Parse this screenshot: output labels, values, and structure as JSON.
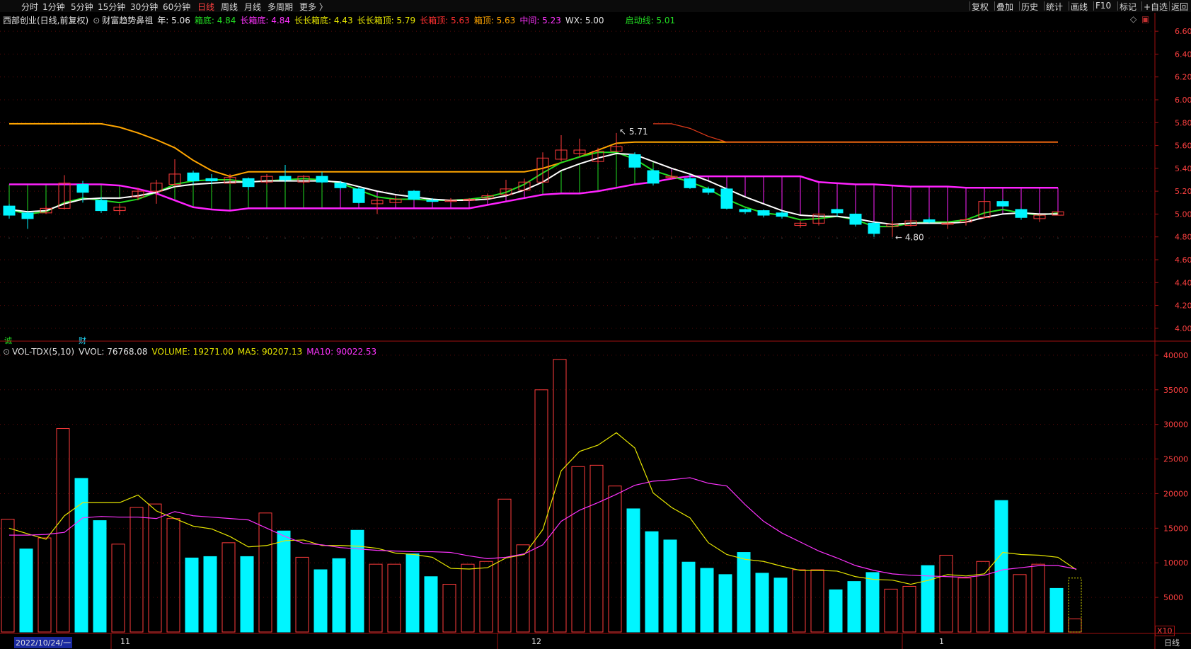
{
  "colors": {
    "up": "#ff3b3b",
    "down": "#00f5ff",
    "ma5": "#e6e600",
    "ma10": "#e020e0",
    "box_top": "#ffa500",
    "long_top": "#e03a1a",
    "box_bottom": "#ff22ff",
    "mid": "#ffffff",
    "start": "#22dd22",
    "axis": "#a01010",
    "grid": "#5a0a0a"
  },
  "toolbar": {
    "periods": [
      "分时",
      "1分钟",
      "5分钟",
      "15分钟",
      "30分钟",
      "60分钟",
      "日线",
      "周线",
      "月线",
      "多周期",
      "更多 〉"
    ],
    "active": "日线",
    "right_tools": [
      "复权",
      "叠加",
      "历史",
      "统计",
      "画线",
      "F10",
      "标记",
      "+自选",
      "返回"
    ]
  },
  "main_legend": {
    "stock": "西部创业(日线,前复权)",
    "indicator": "财富趋势鼻祖",
    "items": [
      {
        "label": "年: 5.06",
        "color": "#e6e6e6"
      },
      {
        "label": "箱底: 4.84",
        "color": "#22dd22"
      },
      {
        "label": "长箱底: 4.84",
        "color": "#ff33ff"
      },
      {
        "label": "长长箱底: 4.43",
        "color": "#e6e600"
      },
      {
        "label": "长长箱顶: 5.79",
        "color": "#e6e600"
      },
      {
        "label": "长箱顶: 5.63",
        "color": "#ff3030"
      },
      {
        "label": "箱顶: 5.63",
        "color": "#ffa500"
      },
      {
        "label": "中间: 5.23",
        "color": "#ff33ff"
      },
      {
        "label": "WX: 5.00",
        "color": "#e6e6e6"
      },
      {
        "label": "启动线: 5.01",
        "color": "#22dd22"
      }
    ]
  },
  "vol_legend": {
    "name": "VOL-TDX(5,10)",
    "items": [
      {
        "label": "VVOL: 76768.08",
        "color": "#e6e6e6"
      },
      {
        "label": "VOLUME: 19271.00",
        "color": "#e6e600"
      },
      {
        "label": "MA5: 90207.13",
        "color": "#e6e600"
      },
      {
        "label": "MA10: 90022.53",
        "color": "#ff33ff"
      }
    ]
  },
  "badges": {
    "left": "诚",
    "right": "财",
    "x10": "X10",
    "period_tab": "日线"
  },
  "date_axis": {
    "start": "2022/10/24/一",
    "months": [
      "11",
      "12",
      "1"
    ]
  },
  "chart_data": [
    {
      "type": "candlestick",
      "title": "西部创业(日线,前复权)",
      "ylim": [
        3.9,
        6.7
      ],
      "yticks": [
        4.0,
        4.2,
        4.4,
        4.6,
        4.8,
        5.0,
        5.2,
        5.4,
        5.6,
        5.8,
        6.0,
        6.2,
        6.4,
        6.6
      ],
      "annotations": [
        {
          "label": "5.71",
          "index": 33
        },
        {
          "label": "4.80",
          "index": 48
        }
      ],
      "candles": [
        {
          "o": 5.07,
          "c": 4.99,
          "h": 5.09,
          "l": 4.96
        },
        {
          "o": 5.01,
          "c": 4.96,
          "h": 5.02,
          "l": 4.87
        },
        {
          "o": 5.01,
          "c": 5.05,
          "h": 5.07,
          "l": 5.0
        },
        {
          "o": 5.05,
          "c": 5.27,
          "h": 5.34,
          "l": 5.04
        },
        {
          "o": 5.26,
          "c": 5.19,
          "h": 5.29,
          "l": 5.1
        },
        {
          "o": 5.12,
          "c": 5.03,
          "h": 5.15,
          "l": 5.01
        },
        {
          "o": 5.03,
          "c": 5.06,
          "h": 5.09,
          "l": 4.99
        },
        {
          "o": 5.15,
          "c": 5.2,
          "h": 5.23,
          "l": 5.12
        },
        {
          "o": 5.2,
          "c": 5.27,
          "h": 5.3,
          "l": 5.09
        },
        {
          "o": 5.26,
          "c": 5.35,
          "h": 5.48,
          "l": 5.24
        },
        {
          "o": 5.36,
          "c": 5.29,
          "h": 5.38,
          "l": 5.26
        },
        {
          "o": 5.31,
          "c": 5.29,
          "h": 5.35,
          "l": 5.26
        },
        {
          "o": 5.27,
          "c": 5.32,
          "h": 5.35,
          "l": 5.27
        },
        {
          "o": 5.31,
          "c": 5.24,
          "h": 5.32,
          "l": 5.21
        },
        {
          "o": 5.28,
          "c": 5.33,
          "h": 5.35,
          "l": 5.26
        },
        {
          "o": 5.33,
          "c": 5.3,
          "h": 5.43,
          "l": 5.28
        },
        {
          "o": 5.28,
          "c": 5.33,
          "h": 5.34,
          "l": 5.26
        },
        {
          "o": 5.33,
          "c": 5.28,
          "h": 5.37,
          "l": 5.27
        },
        {
          "o": 5.27,
          "c": 5.23,
          "h": 5.29,
          "l": 5.21
        },
        {
          "o": 5.22,
          "c": 5.1,
          "h": 5.24,
          "l": 5.09
        },
        {
          "o": 5.09,
          "c": 5.12,
          "h": 5.14,
          "l": 5.0
        },
        {
          "o": 5.1,
          "c": 5.13,
          "h": 5.16,
          "l": 5.09
        },
        {
          "o": 5.2,
          "c": 5.13,
          "h": 5.21,
          "l": 5.12
        },
        {
          "o": 5.12,
          "c": 5.11,
          "h": 5.14,
          "l": 5.1
        },
        {
          "o": 5.11,
          "c": 5.12,
          "h": 5.14,
          "l": 5.1
        },
        {
          "o": 5.12,
          "c": 5.13,
          "h": 5.14,
          "l": 5.11
        },
        {
          "o": 5.14,
          "c": 5.16,
          "h": 5.18,
          "l": 5.12
        },
        {
          "o": 5.17,
          "c": 5.22,
          "h": 5.3,
          "l": 5.16
        },
        {
          "o": 5.21,
          "c": 5.28,
          "h": 5.31,
          "l": 5.2
        },
        {
          "o": 5.28,
          "c": 5.49,
          "h": 5.54,
          "l": 5.27
        },
        {
          "o": 5.48,
          "c": 5.56,
          "h": 5.69,
          "l": 5.46
        },
        {
          "o": 5.53,
          "c": 5.56,
          "h": 5.66,
          "l": 5.5
        },
        {
          "o": 5.46,
          "c": 5.55,
          "h": 5.58,
          "l": 5.44
        },
        {
          "o": 5.55,
          "c": 5.59,
          "h": 5.71,
          "l": 5.54
        },
        {
          "o": 5.52,
          "c": 5.41,
          "h": 5.54,
          "l": 5.39
        },
        {
          "o": 5.38,
          "c": 5.27,
          "h": 5.4,
          "l": 5.25
        },
        {
          "o": 5.33,
          "c": 5.33,
          "h": 5.37,
          "l": 5.3
        },
        {
          "o": 5.31,
          "c": 5.23,
          "h": 5.34,
          "l": 5.22
        },
        {
          "o": 5.22,
          "c": 5.19,
          "h": 5.24,
          "l": 5.17
        },
        {
          "o": 5.22,
          "c": 5.05,
          "h": 5.23,
          "l": 5.04
        },
        {
          "o": 5.04,
          "c": 5.02,
          "h": 5.05,
          "l": 5.0
        },
        {
          "o": 5.03,
          "c": 4.99,
          "h": 5.04,
          "l": 4.97
        },
        {
          "o": 5.01,
          "c": 4.98,
          "h": 5.03,
          "l": 4.96
        },
        {
          "o": 4.9,
          "c": 4.92,
          "h": 4.94,
          "l": 4.88
        },
        {
          "o": 4.92,
          "c": 5.0,
          "h": 5.01,
          "l": 4.9
        },
        {
          "o": 5.04,
          "c": 5.01,
          "h": 5.05,
          "l": 4.98
        },
        {
          "o": 5.0,
          "c": 4.91,
          "h": 5.01,
          "l": 4.89
        },
        {
          "o": 4.92,
          "c": 4.83,
          "h": 4.93,
          "l": 4.8
        },
        {
          "o": 4.89,
          "c": 4.91,
          "h": 4.94,
          "l": 4.8
        },
        {
          "o": 4.9,
          "c": 4.94,
          "h": 4.95,
          "l": 4.89
        },
        {
          "o": 4.95,
          "c": 4.93,
          "h": 4.97,
          "l": 4.92
        },
        {
          "o": 4.91,
          "c": 4.92,
          "h": 4.94,
          "l": 4.87
        },
        {
          "o": 4.93,
          "c": 4.95,
          "h": 4.97,
          "l": 4.9
        },
        {
          "o": 4.97,
          "c": 5.11,
          "h": 5.12,
          "l": 4.96
        },
        {
          "o": 5.11,
          "c": 5.07,
          "h": 5.13,
          "l": 5.06
        },
        {
          "o": 5.04,
          "c": 4.97,
          "h": 5.05,
          "l": 4.95
        },
        {
          "o": 4.96,
          "c": 4.99,
          "h": 5.0,
          "l": 4.93
        },
        {
          "o": 4.99,
          "c": 5.02,
          "h": 5.02,
          "l": 4.99
        }
      ],
      "series": [
        {
          "type": "step",
          "color": "#ffa500",
          "values": [
            5.79,
            5.79,
            5.79,
            5.79,
            5.79,
            5.79,
            5.76,
            5.71,
            5.65,
            5.58,
            5.47,
            5.38,
            5.33,
            5.37,
            5.37,
            5.37,
            5.37,
            5.37,
            5.37,
            5.37,
            5.37,
            5.37,
            5.37,
            5.37,
            5.37,
            5.37,
            5.37,
            5.37,
            5.37,
            5.4,
            5.45,
            5.5,
            5.56,
            5.62,
            5.63,
            5.63,
            5.63,
            5.63,
            5.63,
            5.63,
            5.63,
            5.63,
            5.63,
            5.63,
            5.63,
            5.63,
            5.63,
            5.63,
            5.63,
            5.63,
            5.63,
            5.63,
            5.63,
            5.63,
            5.63,
            5.63,
            5.63,
            5.63
          ]
        },
        {
          "type": "line",
          "color": "#e03a1a",
          "values": [
            null,
            null,
            null,
            null,
            null,
            null,
            null,
            null,
            null,
            null,
            null,
            null,
            null,
            null,
            null,
            null,
            null,
            null,
            null,
            null,
            null,
            null,
            null,
            null,
            null,
            null,
            null,
            null,
            null,
            null,
            null,
            null,
            null,
            null,
            null,
            5.79,
            5.79,
            5.75,
            5.68,
            5.63,
            5.63,
            5.63,
            5.63,
            5.63,
            5.63,
            5.63,
            5.63,
            5.63,
            5.63,
            5.63,
            5.63,
            5.63,
            5.63,
            5.63,
            5.63,
            5.63,
            5.63,
            5.63
          ]
        },
        {
          "type": "band",
          "color": "#ff22ff",
          "values": [
            5.26,
            5.26,
            5.26,
            5.26,
            5.26,
            5.26,
            5.25,
            5.22,
            5.18,
            5.12,
            5.06,
            5.04,
            5.03,
            5.05,
            5.05,
            5.05,
            5.05,
            5.05,
            5.05,
            5.05,
            5.05,
            5.05,
            5.05,
            5.05,
            5.05,
            5.05,
            5.08,
            5.11,
            5.14,
            5.17,
            5.18,
            5.18,
            5.2,
            5.23,
            5.26,
            5.28,
            5.31,
            5.33,
            5.33,
            5.33,
            5.33,
            5.33,
            5.33,
            5.33,
            5.28,
            5.27,
            5.26,
            5.26,
            5.25,
            5.24,
            5.24,
            5.24,
            5.23,
            5.23,
            5.23,
            5.23,
            5.23,
            5.23
          ]
        },
        {
          "type": "line",
          "color": "#ffffff",
          "values": [
            5.04,
            5.02,
            5.03,
            5.09,
            5.13,
            5.14,
            5.14,
            5.16,
            5.19,
            5.24,
            5.26,
            5.27,
            5.28,
            5.28,
            5.29,
            5.29,
            5.29,
            5.29,
            5.28,
            5.24,
            5.2,
            5.17,
            5.15,
            5.13,
            5.12,
            5.12,
            5.13,
            5.16,
            5.21,
            5.28,
            5.38,
            5.44,
            5.49,
            5.53,
            5.52,
            5.46,
            5.4,
            5.35,
            5.29,
            5.22,
            5.15,
            5.09,
            5.03,
            4.99,
            4.98,
            4.98,
            4.96,
            4.93,
            4.91,
            4.92,
            4.92,
            4.92,
            4.93,
            4.97,
            5.0,
            5.01,
            5.0,
            5.0
          ]
        },
        {
          "type": "line",
          "color": "#22dd22",
          "values": [
            5.04,
            5.0,
            5.02,
            5.1,
            5.14,
            5.12,
            5.1,
            5.13,
            5.19,
            5.26,
            5.29,
            5.3,
            5.3,
            5.28,
            5.29,
            5.3,
            5.31,
            5.3,
            5.27,
            5.21,
            5.15,
            5.13,
            5.13,
            5.12,
            5.12,
            5.13,
            5.15,
            5.19,
            5.26,
            5.36,
            5.45,
            5.5,
            5.54,
            5.54,
            5.48,
            5.38,
            5.33,
            5.28,
            5.22,
            5.13,
            5.06,
            5.01,
            4.99,
            4.95,
            4.96,
            4.98,
            4.95,
            4.89,
            4.89,
            4.92,
            4.93,
            4.93,
            4.95,
            5.01,
            5.04,
            5.01,
            4.99,
            5.01
          ]
        }
      ]
    },
    {
      "type": "bar",
      "title": "VOL-TDX(5,10)",
      "ylim": [
        0,
        40500
      ],
      "yticks": [
        5000,
        10000,
        15000,
        20000,
        25000,
        30000,
        35000,
        40000
      ],
      "volumes": [
        16300,
        12000,
        13600,
        29400,
        22200,
        16100,
        12700,
        18000,
        18500,
        16400,
        10700,
        10900,
        12900,
        10900,
        17200,
        14600,
        10800,
        9000,
        10600,
        14700,
        9800,
        9800,
        11300,
        8000,
        6900,
        9800,
        10200,
        19200,
        12600,
        35000,
        39400,
        23900,
        24100,
        21100,
        17800,
        14500,
        13300,
        10100,
        9200,
        8300,
        11500,
        8500,
        7800,
        9000,
        9000,
        6100,
        7300,
        8600,
        6200,
        6600,
        9600,
        11100,
        7800,
        10200,
        19000,
        8300,
        9800,
        6300,
        1900
      ],
      "candle_up": [
        true,
        false,
        true,
        true,
        false,
        false,
        true,
        true,
        true,
        true,
        false,
        false,
        true,
        false,
        true,
        false,
        true,
        false,
        false,
        false,
        true,
        true,
        false,
        false,
        true,
        true,
        true,
        true,
        true,
        true,
        true,
        true,
        true,
        true,
        false,
        false,
        false,
        false,
        false,
        false,
        false,
        false,
        false,
        true,
        true,
        false,
        false,
        false,
        true,
        true,
        false,
        true,
        true,
        true,
        false,
        true,
        true,
        false
      ],
      "series": [
        {
          "name": "MA5",
          "color": "#e6e600",
          "values": [
            15000,
            14200,
            13400,
            16800,
            18700,
            18700,
            18700,
            19800,
            17500,
            16400,
            15300,
            14900,
            13800,
            12300,
            12500,
            13200,
            13300,
            12500,
            12500,
            12400,
            12100,
            11400,
            11200,
            10800,
            9200,
            9100,
            9300,
            10700,
            11200,
            14800,
            23300,
            26100,
            27000,
            28800,
            26600,
            20100,
            18000,
            16500,
            12900,
            11200,
            10500,
            10200,
            9500,
            8900,
            8900,
            8800,
            8000,
            7600,
            7500,
            6900,
            7500,
            8300,
            8100,
            8400,
            11500,
            11200,
            11100,
            10800,
            9000
          ]
        },
        {
          "name": "MA10",
          "color": "#ff33ff",
          "values": [
            14000,
            14000,
            14100,
            14400,
            16500,
            16700,
            16600,
            16600,
            16400,
            17400,
            16800,
            16600,
            16400,
            16200,
            15000,
            13800,
            12800,
            12600,
            12200,
            12000,
            11800,
            11700,
            11600,
            11600,
            11500,
            11000,
            10600,
            10800,
            11300,
            12600,
            16000,
            17600,
            18700,
            19900,
            21200,
            21800,
            22000,
            22300,
            21500,
            21100,
            18400,
            16000,
            14300,
            13000,
            11700,
            10700,
            9600,
            8900,
            8400,
            8200,
            8100,
            8000,
            7900,
            8200,
            9000,
            9300,
            9600,
            9600,
            9100
          ]
        }
      ]
    }
  ]
}
